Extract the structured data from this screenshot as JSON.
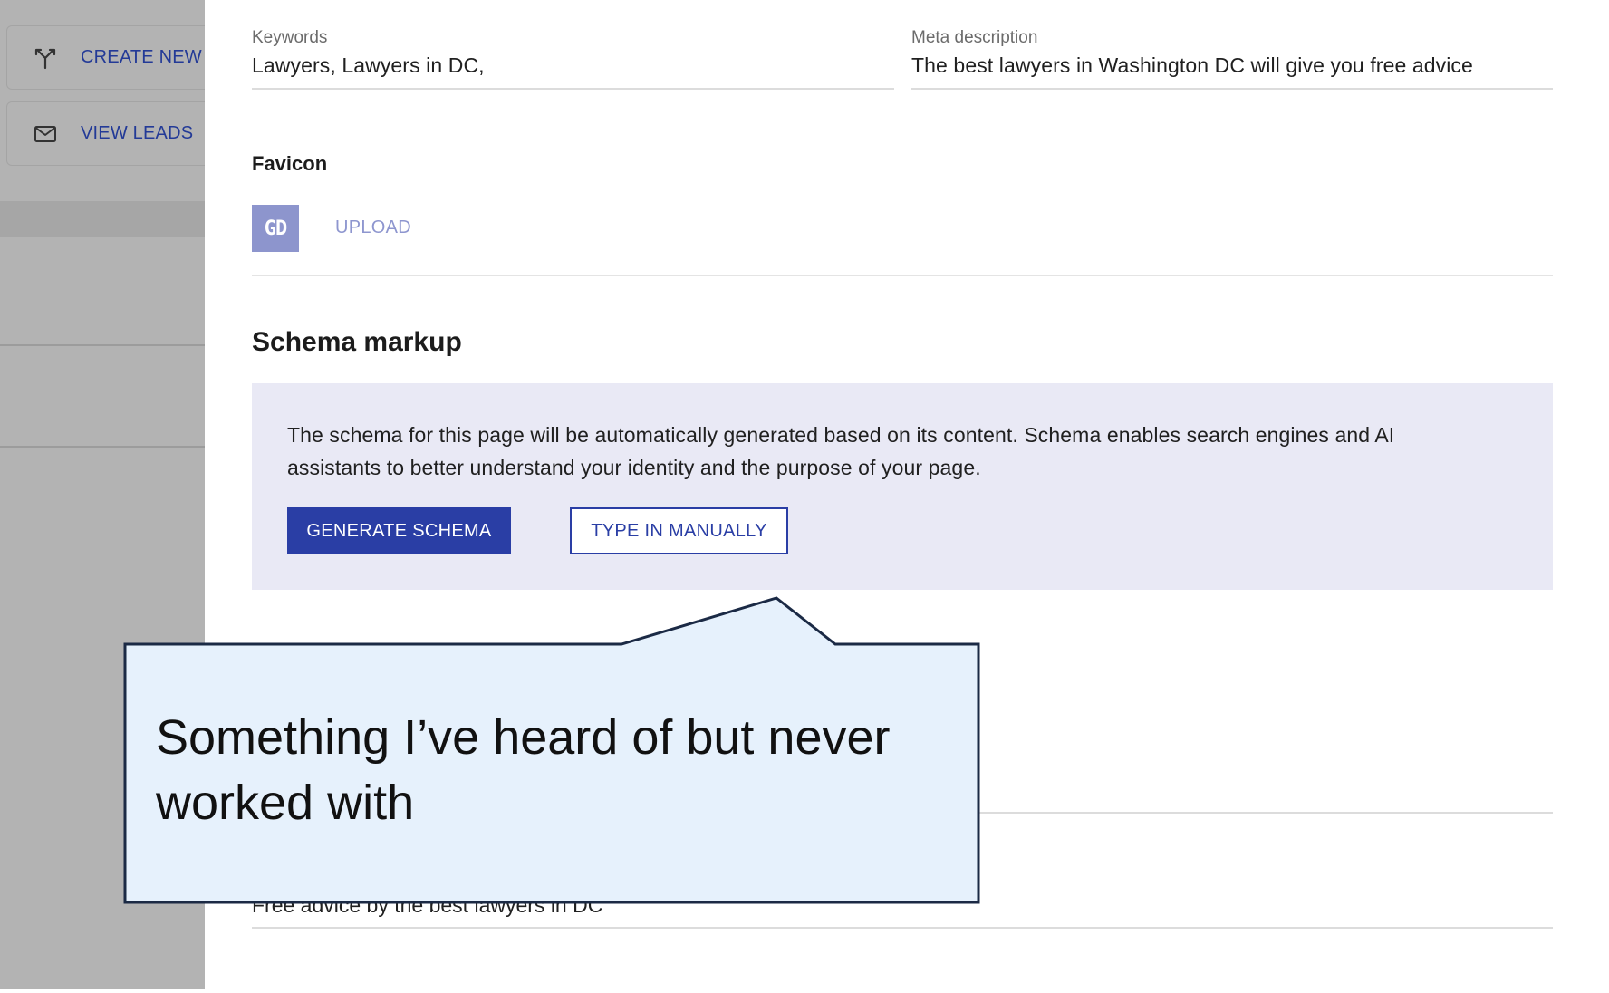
{
  "sidebar": {
    "create_button_label": "CREATE NEW E",
    "create_icon": "fork-arrows-icon",
    "leads_button_label": "VIEW LEADS",
    "leads_icon": "mail-icon"
  },
  "seo": {
    "keywords_label": "Keywords",
    "keywords_value": "Lawyers, Lawyers in DC,",
    "meta_label": "Meta description",
    "meta_value": "The best lawyers in Washington DC will give you free advice"
  },
  "favicon": {
    "title": "Favicon",
    "thumb_text": "GD",
    "upload_label": "UPLOAD"
  },
  "schema": {
    "title": "Schema markup",
    "description": "The schema for this page will be automatically generated based on its content. Schema enables search engines and AI assistants to better understand your identity and the purpose of your page.",
    "generate_label": "GENERATE SCHEMA",
    "manual_label": "TYPE IN MANUALLY"
  },
  "lower_field": {
    "value": "Free advice by the best lawyers in DC"
  },
  "callout": {
    "text": "Something I’ve heard of but never worked with"
  },
  "colors": {
    "accent": "#2a3ea5",
    "callout_fill": "#e6f1fc",
    "callout_stroke": "#1b2a45",
    "schema_box": "#e9e9f5",
    "backdrop": "#b3b3b3"
  }
}
